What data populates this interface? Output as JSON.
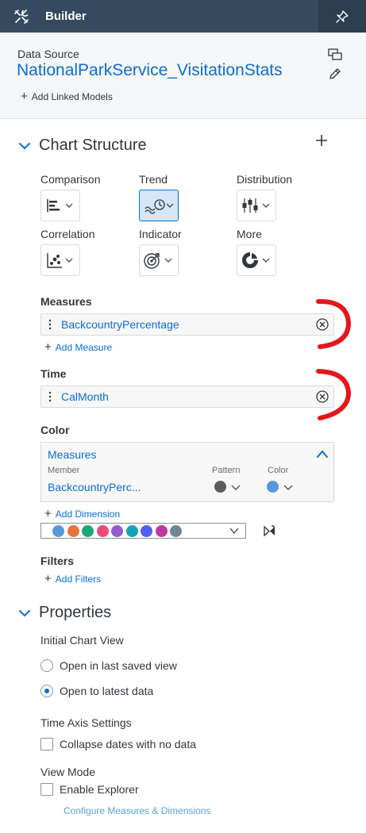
{
  "header": {
    "title": "Builder",
    "icon": "tools-icon",
    "right_icon": "pin-icon",
    "background": "#354a5f"
  },
  "data_source": {
    "label": "Data Source",
    "name": "NationalParkService_VisitationStats",
    "add_linked_models": "Add Linked Models"
  },
  "chart_structure": {
    "title": "Chart Structure",
    "types": [
      {
        "label": "Comparison",
        "icon": "bar-chart-icon",
        "active": false
      },
      {
        "label": "Trend",
        "icon": "trend-icon",
        "active": true
      },
      {
        "label": "Distribution",
        "icon": "distribution-icon",
        "active": false
      },
      {
        "label": "Correlation",
        "icon": "scatter-icon",
        "active": false
      },
      {
        "label": "Indicator",
        "icon": "target-icon",
        "active": false
      },
      {
        "label": "More",
        "icon": "donut-icon",
        "active": false
      }
    ],
    "measures": {
      "label": "Measures",
      "value": "BackcountryPercentage",
      "add": "Add Measure"
    },
    "time": {
      "label": "Time",
      "value": "CalMonth"
    },
    "color": {
      "label": "Color",
      "panel_title": "Measures",
      "col_member": "Member",
      "col_pattern": "Pattern",
      "col_color": "Color",
      "member": "BackcountryPerc...",
      "pattern_color": "#5b5b5b",
      "color_value": "#5899da",
      "add_dimension": "Add Dimension",
      "palette": [
        "#5899da",
        "#e8743b",
        "#19a979",
        "#ed4a7b",
        "#945ecf",
        "#13a4b4",
        "#525df4",
        "#bf399e",
        "#6c8893"
      ]
    },
    "filters": {
      "label": "Filters",
      "add": "Add Filters"
    }
  },
  "properties": {
    "title": "Properties",
    "initial_chart_view": "Initial Chart View",
    "option_saved": "Open in last saved view",
    "option_latest": "Open to latest data",
    "selected": "latest",
    "time_axis_settings": "Time Axis Settings",
    "collapse_dates": "Collapse dates with no data",
    "view_mode": "View Mode",
    "enable_explorer": "Enable Explorer",
    "configure_link": "Configure Measures & Dimensions"
  },
  "colors": {
    "accent": "#0a6ed1",
    "annotation": "#e5161c"
  }
}
